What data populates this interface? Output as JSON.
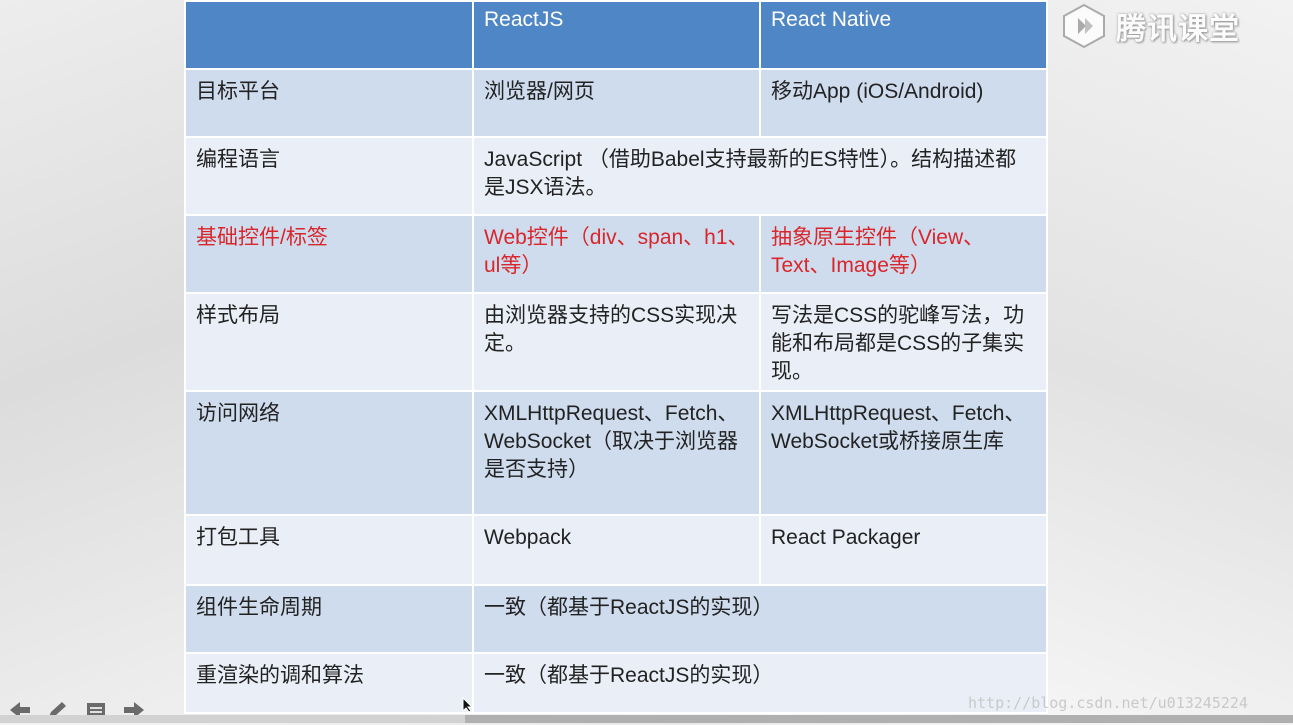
{
  "header": [
    "",
    "ReactJS",
    "React Native"
  ],
  "rows": [
    {
      "label": "目标平台",
      "react": "浏览器/网页",
      "native": "移动App (iOS/Android)",
      "merged": false,
      "style": "odd"
    },
    {
      "label": "编程语言",
      "react": "JavaScript （借助Babel支持最新的ES特性）。结构描述都是JSX语法。",
      "native": "",
      "merged": true,
      "style": "even"
    },
    {
      "label": "基础控件/标签",
      "react": "Web控件（div、span、h1、ul等）",
      "native": "抽象原生控件（View、Text、Image等）",
      "merged": false,
      "style": "odd red"
    },
    {
      "label": "样式布局",
      "react": "由浏览器支持的CSS实现决定。",
      "native": "写法是CSS的驼峰写法，功能和布局都是CSS的子集实现。",
      "merged": false,
      "style": "even"
    },
    {
      "label": "访问网络",
      "react": "XMLHttpRequest、Fetch、WebSocket（取决于浏览器是否支持）",
      "native": "XMLHttpRequest、Fetch、WebSocket或桥接原生库",
      "merged": false,
      "style": "odd"
    },
    {
      "label": "打包工具",
      "react": "Webpack",
      "native": "React Packager",
      "merged": false,
      "style": "even"
    },
    {
      "label": "组件生命周期",
      "react": "一致（都基于ReactJS的实现）",
      "native": "",
      "merged": true,
      "style": "odd"
    },
    {
      "label": "重渲染的调和算法",
      "react": "一致（都基于ReactJS的实现）",
      "native": "",
      "merged": true,
      "style": "even"
    }
  ],
  "logo": {
    "text": "腾讯课堂",
    "icon": "tencent-classroom-logo-icon"
  },
  "watermark": "http://blog.csdn.net/u013245224",
  "player": {
    "progress_percent": 36
  },
  "colors": {
    "header": "#4f86c6",
    "row_odd": "#cfdcee",
    "row_even": "#e9eef7",
    "highlight_text": "#d8262a"
  }
}
